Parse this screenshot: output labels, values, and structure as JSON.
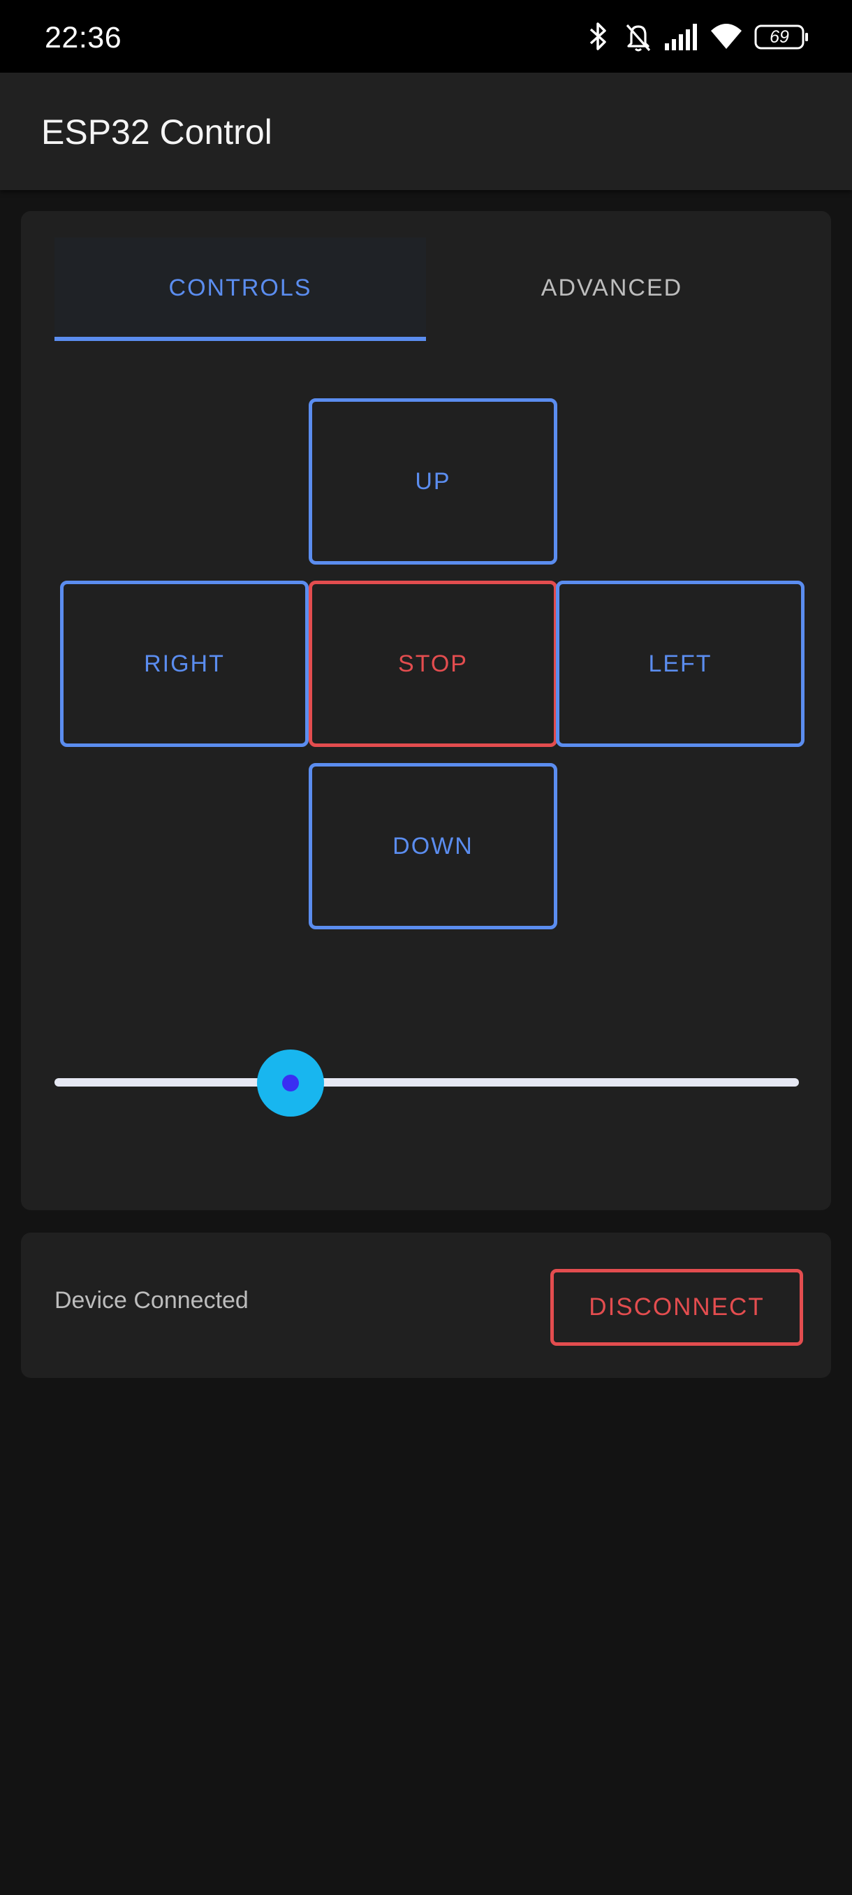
{
  "status_bar": {
    "time": "22:36",
    "battery_level": "69",
    "icons": [
      "bluetooth-icon",
      "bell-muted-icon",
      "signal-icon",
      "wifi-icon",
      "battery-icon"
    ]
  },
  "app_bar": {
    "title": "ESP32 Control"
  },
  "tabs": [
    {
      "label": "CONTROLS",
      "selected": true
    },
    {
      "label": "ADVANCED",
      "selected": false
    }
  ],
  "dpad": {
    "up": "UP",
    "right": "RIGHT",
    "stop": "STOP",
    "left": "LEFT",
    "down": "DOWN"
  },
  "slider": {
    "value_fraction": 0.317
  },
  "connection": {
    "status_text": "Device Connected",
    "disconnect_label": "DISCONNECT"
  },
  "colors": {
    "accent": "#5b8def",
    "danger": "#e34d4f",
    "slider_thumb": "#18b6ef",
    "background": "#131313",
    "surface": "#202020"
  }
}
